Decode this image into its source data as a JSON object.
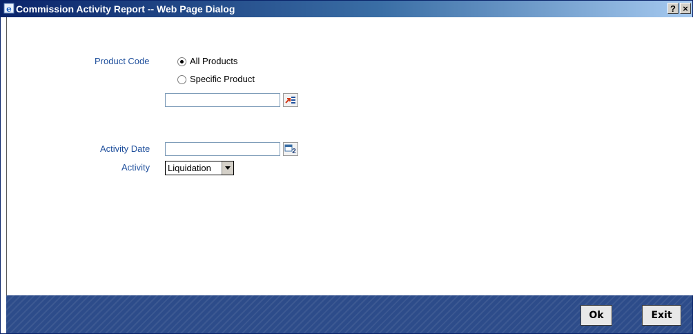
{
  "window": {
    "title": "Commission Activity Report -- Web Page Dialog",
    "help_label": "?",
    "close_label": "×"
  },
  "form": {
    "product_code": {
      "label": "Product Code",
      "options": [
        {
          "label": "All Products",
          "selected": true
        },
        {
          "label": "Specific Product",
          "selected": false
        }
      ],
      "value": ""
    },
    "activity_date": {
      "label": "Activity Date",
      "value": ""
    },
    "activity": {
      "label": "Activity",
      "value": "Liquidation"
    }
  },
  "footer": {
    "ok_label": "Ok",
    "exit_label": "Exit"
  },
  "colors": {
    "label_blue": "#1f4f9c",
    "footer_blue": "#2d4c8a",
    "title_blue": "#0a246a"
  }
}
